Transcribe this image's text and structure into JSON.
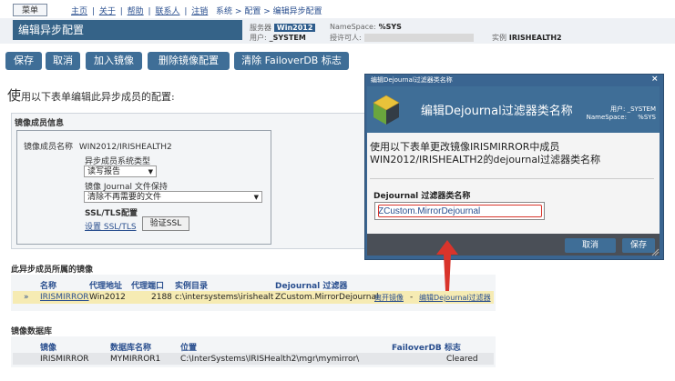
{
  "top_nav": {
    "menu_button": "菜单",
    "links": [
      "主页",
      "|",
      "关于",
      "|",
      "帮助",
      "|",
      "联系人",
      "|",
      "注销"
    ],
    "breadcrumbs": [
      "系统",
      ">",
      "配置",
      ">",
      "编辑异步配置"
    ]
  },
  "header": {
    "title": "编辑异步配置",
    "server_label": "服务器",
    "server_value": "Win2012",
    "namespace_label": "NameSpace:",
    "namespace_value": "%SYS",
    "user_label": "用户:",
    "user_value": "_SYSTEM",
    "license_label": "授许可人:",
    "instance_label": "实例",
    "instance_value": "IRISHEALTH2"
  },
  "toolbar": {
    "save": "保存",
    "cancel": "取消",
    "join_mirror": "加入镜像",
    "remove_mirror": "删除镜像配置",
    "clear_failover": "清除 FailoverDB 标志"
  },
  "intro": {
    "big": "使",
    "rest": "用以下表单编辑此异步成员的配置:"
  },
  "member_info": {
    "title": "镜像成员信息",
    "member_name_label": "镜像成员名称",
    "member_name_value": "WIN2012/IRISHEALTH2",
    "system_type_label": "异步成员系统类型",
    "system_type_value": "读写报告",
    "journal_label": "镜像 Journal 文件保持",
    "journal_value": "清除不再需要的文件",
    "ssl_label": "SSL/TLS配置",
    "ssl_link": "设置 SSL/TLS",
    "verify_ssl": "验证SSL"
  },
  "mirrors": {
    "title": "此异步成员所属的镜像",
    "headers": [
      "名称",
      "代理地址",
      "代理端口",
      "实例目录",
      "Dejournal 过滤器"
    ],
    "row": {
      "marker": "»",
      "name": "IRISMIRROR",
      "agent_address": "Win2012",
      "agent_port": "2188",
      "instance_dir": "c:\\intersystems\\irishealth1\\",
      "filter": "ZCustom.MirrorDejournal",
      "leave_link": "离开镜像",
      "sep": "-",
      "edit_filter_link": "编辑Dejournal过滤器"
    }
  },
  "databases": {
    "title": "镜像数据库",
    "headers": [
      "镜像",
      "数据库名称",
      "位置",
      "FailoverDB 标志"
    ],
    "row": {
      "mirror": "IRISMIRROR",
      "db_name": "MYMIRROR1",
      "location": "C:\\InterSystems\\IRISHealth2\\mgr\\mymirror\\",
      "flag": "Cleared"
    }
  },
  "dialog": {
    "titlebar": "编辑Dejournal过滤器类名称",
    "close": "×",
    "heading": "编辑Dejournal过滤器类名称",
    "user_label": "用户:",
    "user_value": "_SYSTEM",
    "namespace_label": "NameSpace:",
    "namespace_value": "%SYS",
    "description": "使用以下表单更改镜像IRISMIRROR中成员WIN2012/IRISHEALTH2的dejournal过滤器类名称",
    "field_label": "Dejournal 过滤器类名称",
    "field_value": "ZCustom.MirrorDejournal",
    "cancel": "取消",
    "save": "保存"
  },
  "colors": {
    "header_blue": "#356388",
    "button_blue": "#3f6e97",
    "highlight_row": "#f6ebb3",
    "annotation_red": "#d9342b"
  }
}
